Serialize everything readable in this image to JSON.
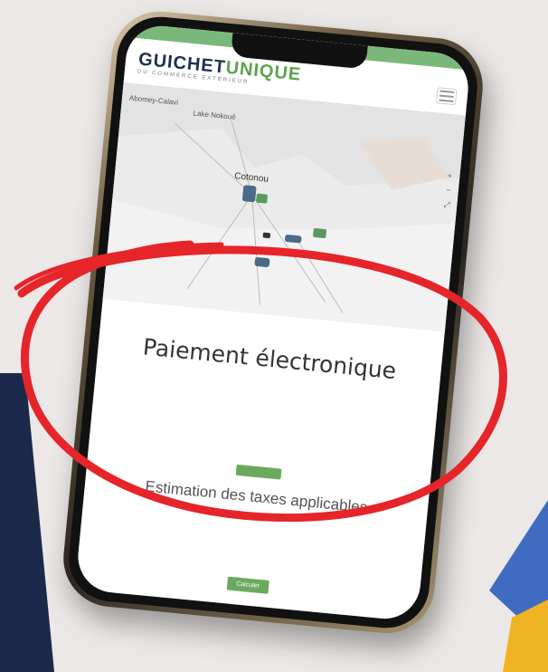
{
  "site": {
    "logo_part1": "GUICHET",
    "logo_part2": "UNIQUE",
    "logo_tagline": "DU COMMERCE EXTÉRIEUR"
  },
  "map": {
    "labels": {
      "abomey_calavi": "Abomey-Calavi",
      "lake_nokoue": "Lake Nokoué",
      "cotonou": "Cotonou"
    }
  },
  "content": {
    "payment_heading": "Paiement électronique",
    "estimation_text": "Estimation des taxes applicables",
    "calculate_button": "Calculer"
  },
  "colors": {
    "brand_navy": "#1f2f52",
    "brand_green": "#5ba34f",
    "highlight_red": "#e5252a",
    "background": "#ece8e7"
  },
  "icons": {
    "menu": "hamburger-icon",
    "vehicles": "vehicle-icon"
  }
}
